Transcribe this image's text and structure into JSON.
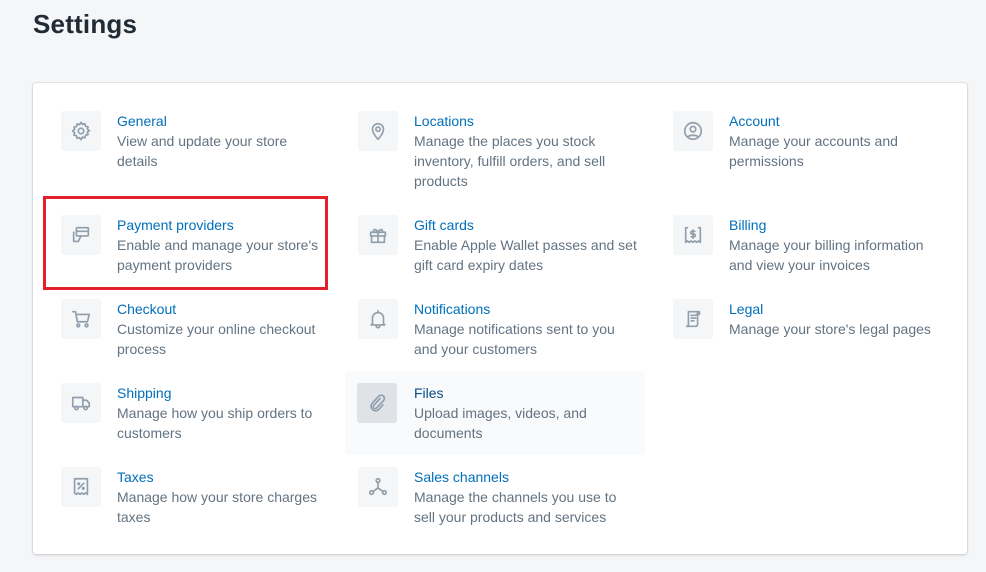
{
  "page": {
    "title": "Settings"
  },
  "highlight_color": "#e3202b",
  "colors": {
    "link": "#006fbb",
    "text_subdued": "#637381",
    "icon": "#919eab",
    "background": "#f4f6f8"
  },
  "items": [
    {
      "title": "General",
      "desc": [
        "View and update your store",
        "details"
      ],
      "icon": "gear-icon"
    },
    {
      "title": "Payment providers",
      "desc": [
        "Enable and manage your store's",
        "payment providers"
      ],
      "icon": "payment-icon",
      "highlighted": true
    },
    {
      "title": "Checkout",
      "desc": [
        "Customize your online checkout",
        "process"
      ],
      "icon": "cart-icon"
    },
    {
      "title": "Shipping",
      "desc": [
        "Manage how you ship orders to",
        "customers"
      ],
      "icon": "truck-icon"
    },
    {
      "title": "Taxes",
      "desc": [
        "Manage how your store charges",
        "taxes"
      ],
      "icon": "tax-receipt-icon"
    },
    {
      "title": "Locations",
      "desc": [
        "Manage the places you stock",
        "inventory, fulfill orders, and sell",
        "products"
      ],
      "icon": "location-pin-icon"
    },
    {
      "title": "Gift cards",
      "desc": [
        "Enable Apple Wallet passes and set",
        "gift card expiry dates"
      ],
      "icon": "gift-icon"
    },
    {
      "title": "Notifications",
      "desc": [
        "Manage notifications sent to you",
        "and your customers"
      ],
      "icon": "bell-icon"
    },
    {
      "title": "Files",
      "desc": [
        "Upload images, videos, and",
        "documents"
      ],
      "icon": "paperclip-icon",
      "hovered": true
    },
    {
      "title": "Sales channels",
      "desc": [
        "Manage the channels you use to",
        "sell your products and services"
      ],
      "icon": "sales-channels-icon"
    },
    {
      "title": "Account",
      "desc": [
        "Manage your accounts and",
        "permissions"
      ],
      "icon": "account-icon"
    },
    {
      "title": "Billing",
      "desc": [
        "Manage your billing information",
        "and view your invoices"
      ],
      "icon": "billing-icon"
    },
    {
      "title": "Legal",
      "desc": [
        "Manage your store's legal pages"
      ],
      "icon": "legal-scroll-icon"
    }
  ]
}
